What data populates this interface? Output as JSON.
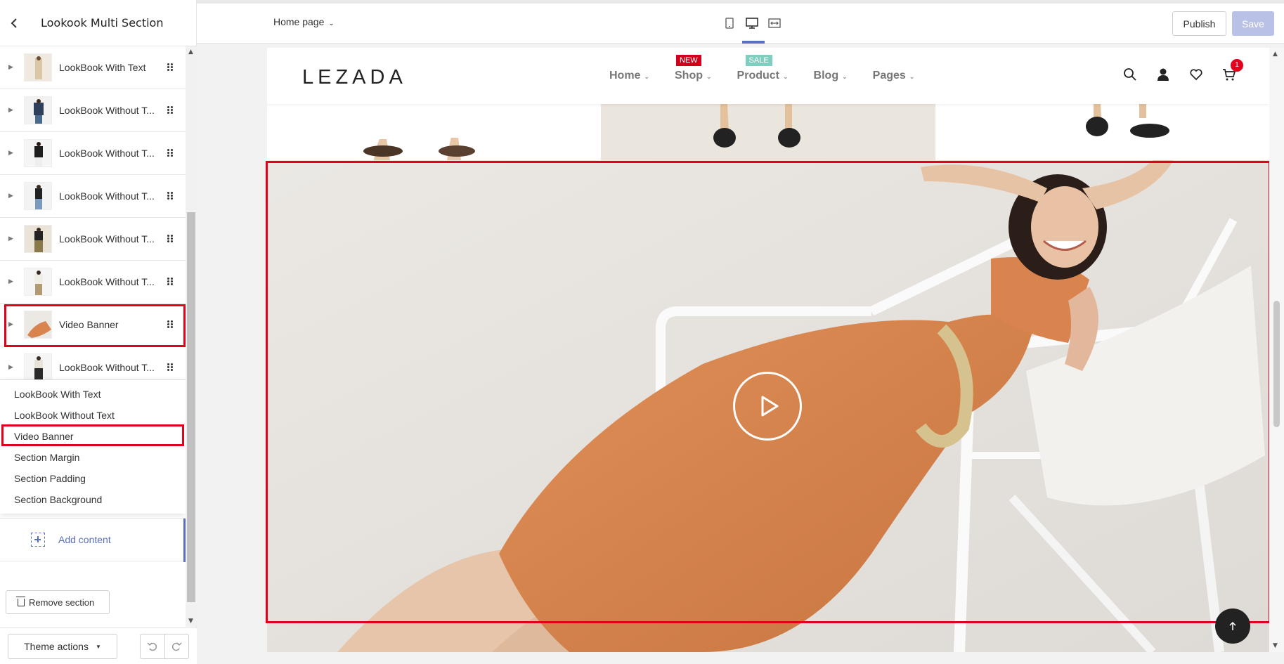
{
  "left_panel": {
    "title": "Lookook Multi Section",
    "blocks": [
      {
        "label": "LookBook With Text"
      },
      {
        "label": "LookBook Without T..."
      },
      {
        "label": "LookBook Without T..."
      },
      {
        "label": "LookBook Without T..."
      },
      {
        "label": "LookBook Without T..."
      },
      {
        "label": "LookBook Without T..."
      },
      {
        "label": "Video Banner"
      },
      {
        "label": "LookBook Without T..."
      }
    ],
    "dropdown": [
      "LookBook With Text",
      "LookBook Without Text",
      "Video Banner",
      "Section Margin",
      "Section Padding",
      "Section Background"
    ],
    "add_content": "Add content",
    "remove_section": "Remove section",
    "theme_actions": "Theme actions"
  },
  "topbar": {
    "page_selector": "Home page",
    "publish": "Publish",
    "save": "Save"
  },
  "site": {
    "logo": "LEZADA",
    "nav": [
      {
        "label": "Home",
        "badge": ""
      },
      {
        "label": "Shop",
        "badge": "NEW",
        "badge_color": "#d0021b"
      },
      {
        "label": "Product",
        "badge": "SALE",
        "badge_color": "#7fcfc0"
      },
      {
        "label": "Blog",
        "badge": ""
      },
      {
        "label": "Pages",
        "badge": ""
      }
    ],
    "cart_count": "1"
  },
  "colors": {
    "accent": "#5a6fc2",
    "highlight": "#e3001b",
    "dress": "#d9834f"
  },
  "icons": [
    "chevron-left-icon",
    "drag-handle-icon",
    "trash-icon",
    "undo-icon",
    "redo-icon",
    "mobile-icon",
    "desktop-icon",
    "fullwidth-icon",
    "search-icon",
    "user-icon",
    "heart-icon",
    "cart-icon",
    "play-icon",
    "arrow-up-icon"
  ]
}
